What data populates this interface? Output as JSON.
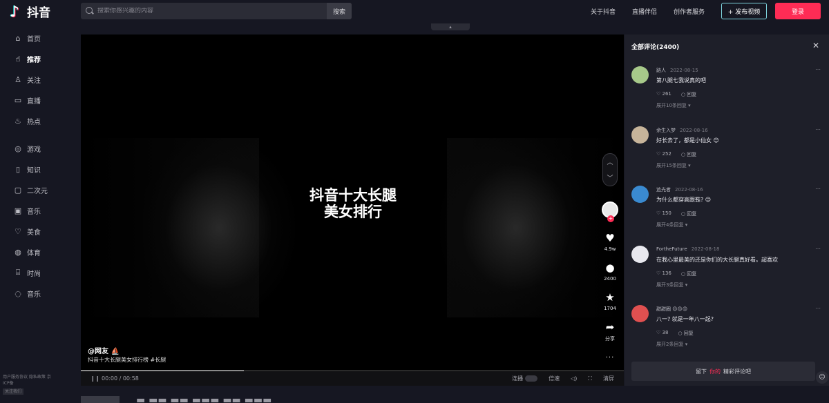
{
  "app": {
    "name": "抖音"
  },
  "search": {
    "placeholder": "搜索你感兴趣的内容",
    "button": "搜索"
  },
  "header": {
    "links": [
      "关于抖音",
      "直播伴侣",
      "创作者服务"
    ],
    "upload": "+ 发布视频",
    "login": "登录"
  },
  "sidebar": {
    "items": [
      {
        "label": "首页",
        "icon": "home-icon"
      },
      {
        "label": "推荐",
        "icon": "thumbs-up-icon",
        "active": true
      },
      {
        "label": "关注",
        "icon": "user-icon"
      },
      {
        "label": "直播",
        "icon": "tv-icon"
      },
      {
        "label": "热点",
        "icon": "flame-icon"
      },
      {
        "label": "游戏",
        "icon": "gamepad-icon"
      },
      {
        "label": "知识",
        "icon": "book-icon"
      },
      {
        "label": "二次元",
        "icon": "anime-icon"
      },
      {
        "label": "音乐",
        "icon": "music-icon"
      },
      {
        "label": "美食",
        "icon": "food-icon"
      },
      {
        "label": "体育",
        "icon": "sports-icon"
      },
      {
        "label": "时尚",
        "icon": "fashion-icon"
      },
      {
        "label": "音乐",
        "icon": "note-icon"
      }
    ],
    "footer": "用户服务协议 隐私政策 京ICP备",
    "footer_tag": "关注我们"
  },
  "video": {
    "title_line1": "抖音十大长腿",
    "title_line2": "美女排行",
    "author": "@网友 ⛵",
    "caption": "抖音十大长腿美女排行榜 #长腿",
    "time": "00:00 / 00:58",
    "controls": {
      "continuous": "连播",
      "speed": "倍速",
      "volume_icon": "volume-icon",
      "fullscreen_icon": "fullscreen-icon",
      "more": "清屏"
    },
    "progress": 0.3
  },
  "actions": {
    "likes": "4.9w",
    "comments": "2400",
    "favorites": "1704",
    "share": "分享",
    "more": "···"
  },
  "comments": {
    "header": "全部评论(2400)",
    "input_prefix": "留下",
    "input_highlight": "你的",
    "input_suffix": "精彩评论吧",
    "items": [
      {
        "user": "路人",
        "time": "2022-08-15",
        "text": "第八腿七我说真的吧",
        "likes": "261",
        "reply": "回复",
        "replies": "展开10条回复",
        "avatar_color": "#a7c98a"
      },
      {
        "user": "余生入梦",
        "time": "2022-08-16",
        "text": "好长去了，都是小仙女 😊",
        "likes": "252",
        "reply": "回复",
        "replies": "展开15条回复",
        "avatar_color": "#c7b49a"
      },
      {
        "user": "追光者",
        "time": "2022-08-16",
        "text": "为什么都穿高跟鞋? 😊",
        "likes": "150",
        "reply": "回复",
        "replies": "展开4条回复",
        "avatar_color": "#3a8ad0"
      },
      {
        "user": "FortheFuture",
        "time": "2022-08-18",
        "text": "在我心里最美的还是你们的大长腿真好看。超喜欢",
        "likes": "136",
        "reply": "回复",
        "replies": "展开3条回复",
        "avatar_color": "#e8e8ee"
      },
      {
        "user": "甜甜圈 😊😊😊",
        "time": "",
        "text": "八一? 就是一年八一起?",
        "likes": "38",
        "reply": "回复",
        "replies": "展开2条回复",
        "avatar_color": "#e05050"
      }
    ]
  }
}
